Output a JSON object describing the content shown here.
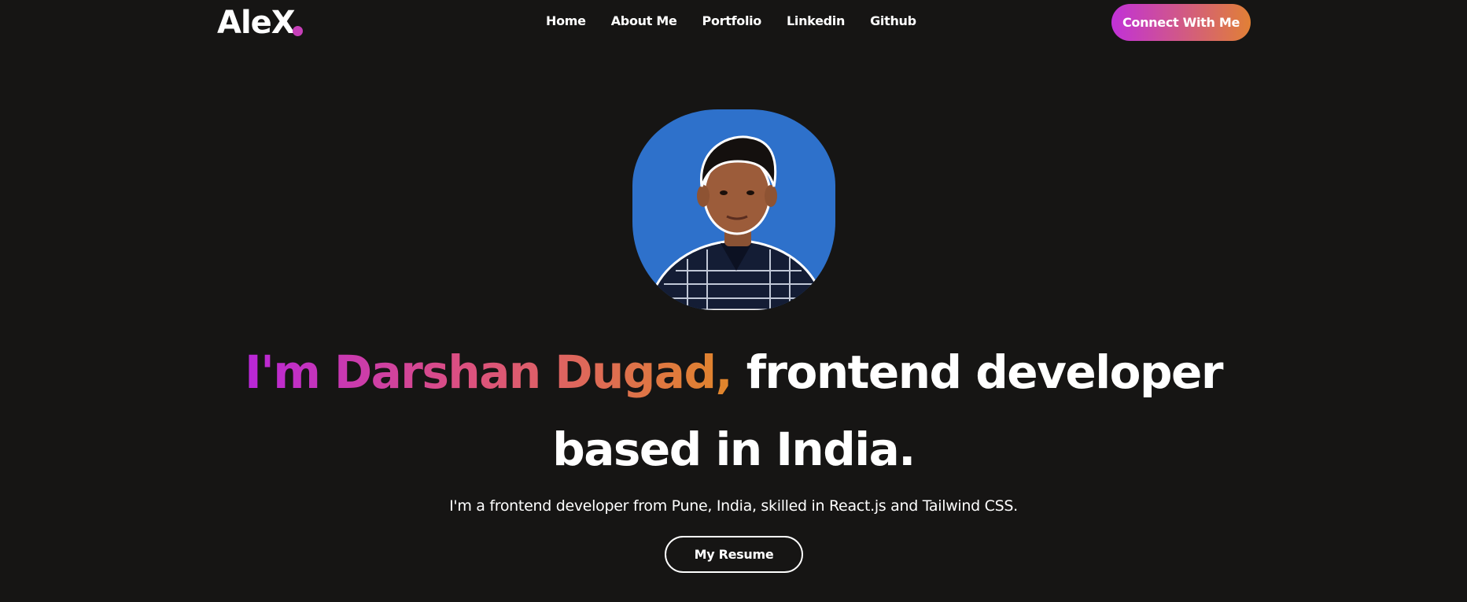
{
  "nav": {
    "logo_text": "AleX",
    "links": [
      "Home",
      "About Me",
      "Portfolio",
      "Linkedin",
      "Github"
    ],
    "cta_label": "Connect With Me"
  },
  "hero": {
    "headline_highlight": "I'm Darshan Dugad,",
    "headline_rest_1": "frontend developer",
    "headline_rest_2": "based in India.",
    "subtitle": "I'm a frontend developer from Pune, India, skilled in React.js and Tailwind CSS.",
    "resume_label": "My Resume"
  },
  "colors": {
    "background": "#161514",
    "gradient_start": "#c131d8",
    "gradient_end": "#e18035",
    "avatar_background": "#2e71cb",
    "logo_dot": "#c63fb8"
  }
}
